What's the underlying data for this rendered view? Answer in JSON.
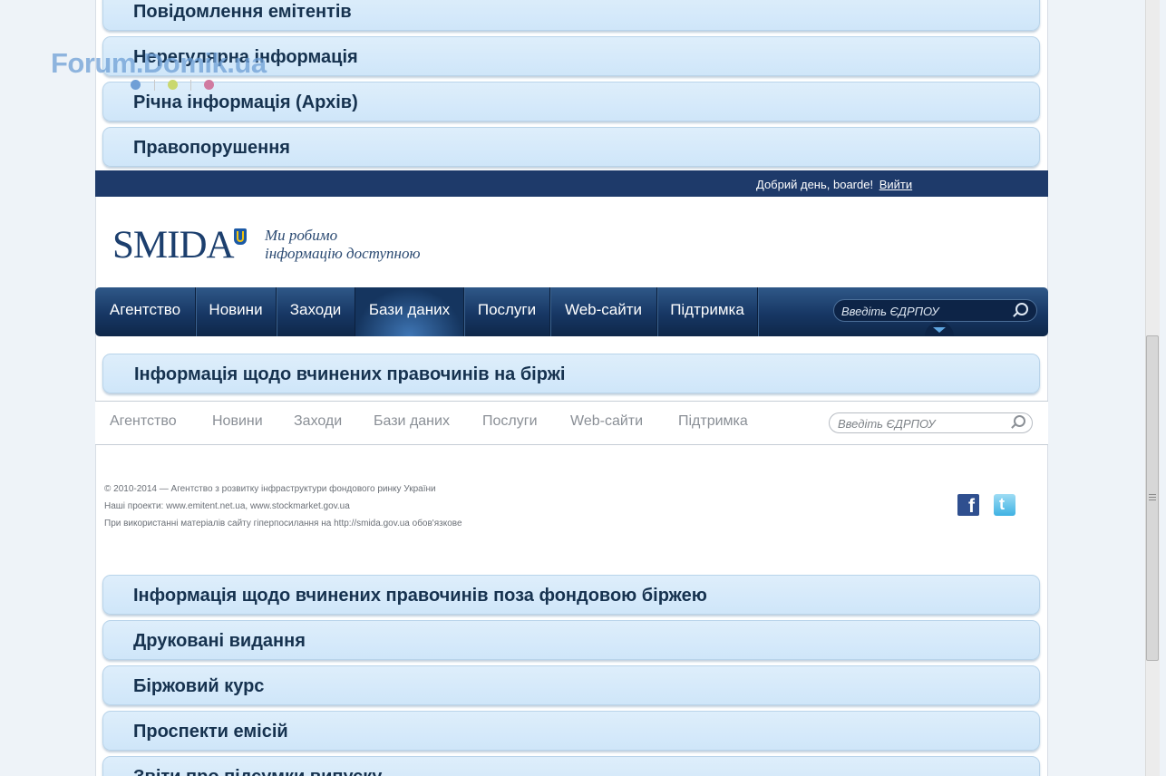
{
  "watermark": "Forum.Domik.ua",
  "accordion_top": [
    {
      "label": "Повідомлення емітентів"
    },
    {
      "label": "Нерегулярна інформація"
    },
    {
      "label": "Річна інформація (Архів)"
    },
    {
      "label": "Правопорушення"
    }
  ],
  "header": {
    "greeting": "Добрий день, boarde!",
    "logout_label": "Вийти",
    "logo_text": "SMIDA",
    "slogan_line1": "Ми робимо",
    "slogan_line2": "інформацію доступною"
  },
  "nav": {
    "items": [
      {
        "label": "Агентство"
      },
      {
        "label": "Новини"
      },
      {
        "label": "Заходи"
      },
      {
        "label": "Бази даних"
      },
      {
        "label": "Послуги"
      },
      {
        "label": "Web-сайти"
      },
      {
        "label": "Підтримка"
      }
    ],
    "active_index": 3,
    "search_placeholder": "Введіть ЄДРПОУ"
  },
  "section_title": "Інформація щодо вчинених правочинів на біржі",
  "footer_nav": {
    "items": [
      {
        "label": "Агентство"
      },
      {
        "label": "Новини"
      },
      {
        "label": "Заходи"
      },
      {
        "label": "Бази даних"
      },
      {
        "label": "Послуги"
      },
      {
        "label": "Web-сайти"
      },
      {
        "label": "Підтримка"
      }
    ],
    "search_placeholder": "Введіть ЄДРПОУ"
  },
  "footer": {
    "copyright": "© 2010-2014 — Агентство з розвитку інфраструктури фондового ринку України",
    "projects": "Наші проекти: www.emitent.net.ua, www.stockmarket.gov.ua",
    "notice": "При використанні матеріалів сайту гіперпосилання на http://smida.gov.ua обов'язкове"
  },
  "accordion_bottom": [
    {
      "label": "Інформація щодо вчинених правочинів поза фондовою біржею"
    },
    {
      "label": "Друковані видання"
    },
    {
      "label": "Біржовий курс"
    },
    {
      "label": "Проспекти емісій"
    },
    {
      "label": "Звіти про підсумки випуску"
    }
  ],
  "colors": {
    "accordion_bg": "#d3e8fa",
    "accordion_text": "#16324f",
    "topbar": "#1e3a6a",
    "nav": "#173764"
  },
  "icons": [
    "search-icon",
    "facebook-icon",
    "twitter-icon",
    "dropdown-arrow-icon",
    "trident-icon"
  ]
}
